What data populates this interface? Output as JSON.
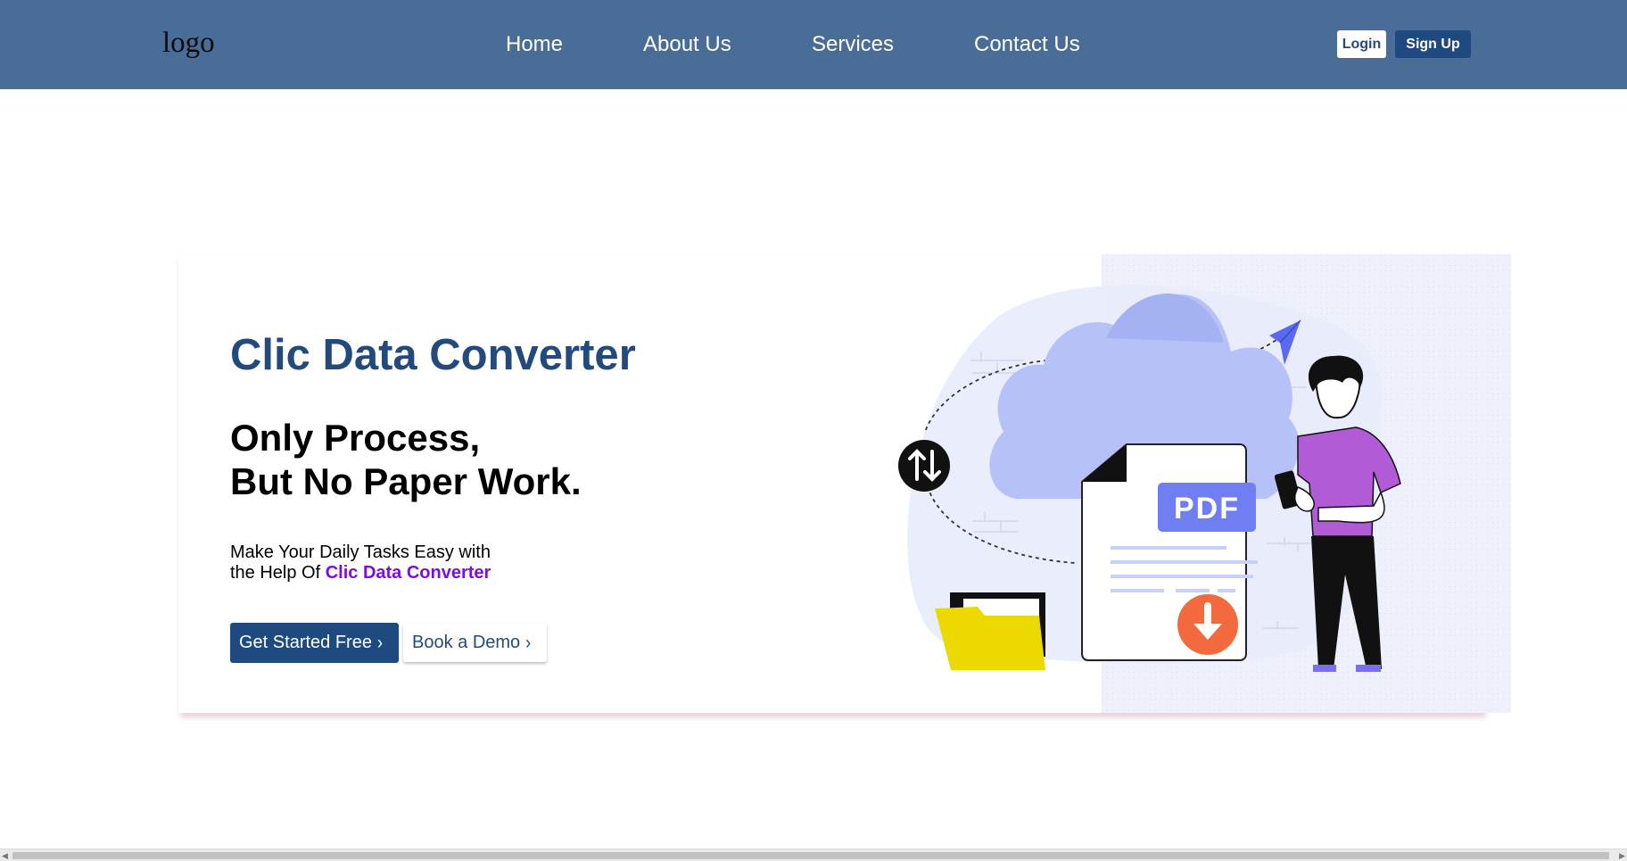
{
  "navbar": {
    "logo": "logo",
    "links": [
      "Home",
      "About Us",
      "Services",
      "Contact Us"
    ],
    "login_label": "Login",
    "signup_label": "Sign Up"
  },
  "hero": {
    "title": "Clic Data Converter",
    "headline_line1": "Only Process,",
    "headline_line2": "But No Paper Work.",
    "desc_prefix": "Make Your Daily Tasks Easy with the Help Of ",
    "desc_brand": "Clic Data Converter",
    "cta_primary": "Get Started Free",
    "cta_secondary": "Book a Demo"
  },
  "illustration": {
    "badge_text": "PDF"
  },
  "colors": {
    "navbar_bg": "#4a6d98",
    "brand_blue": "#234a7c",
    "button_blue": "#1e4a7f",
    "brand_purple": "#7a10e0",
    "pdf_badge": "#6f7ff2",
    "cloud": "#b6c2f7",
    "download_orange": "#f26a3d",
    "folder_yellow": "#ecd900",
    "person_shirt": "#b15bd6"
  },
  "icons": [
    "chevron-right-icon",
    "swap-vertical-icon",
    "download-arrow-icon",
    "paper-plane-icon",
    "folder-icon",
    "phone-icon"
  ]
}
